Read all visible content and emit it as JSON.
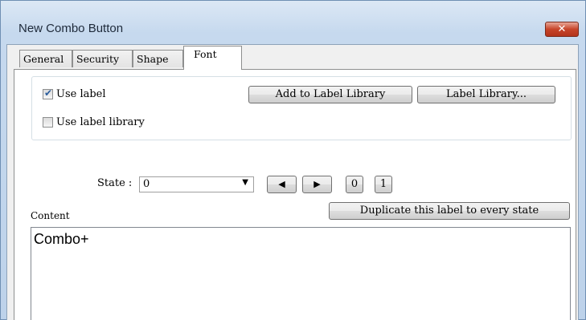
{
  "window": {
    "title": "New Combo Button",
    "close_glyph": "✕"
  },
  "tabs": [
    {
      "label": "General",
      "active": false
    },
    {
      "label": "Security",
      "active": false
    },
    {
      "label": "Shape",
      "active": false
    },
    {
      "label": "Font",
      "active": true
    }
  ],
  "label_group": {
    "use_label": {
      "label": "Use label",
      "checked": true,
      "check_glyph": "✔"
    },
    "use_label_library": {
      "label": "Use label library",
      "checked": false
    },
    "add_to_library_button": "Add to Label Library",
    "label_library_button": "Label Library..."
  },
  "state": {
    "label": "State :",
    "value": "0",
    "dropdown_icon": "▼",
    "prev_icon": "◀",
    "next_icon": "▶",
    "state_0_button": "0",
    "state_1_button": "1"
  },
  "content": {
    "label": "Content",
    "duplicate_button": "Duplicate this label to every state",
    "text": "Combo+"
  },
  "colors": {
    "accent": "#c7452a",
    "check": "#2b5d9c"
  }
}
